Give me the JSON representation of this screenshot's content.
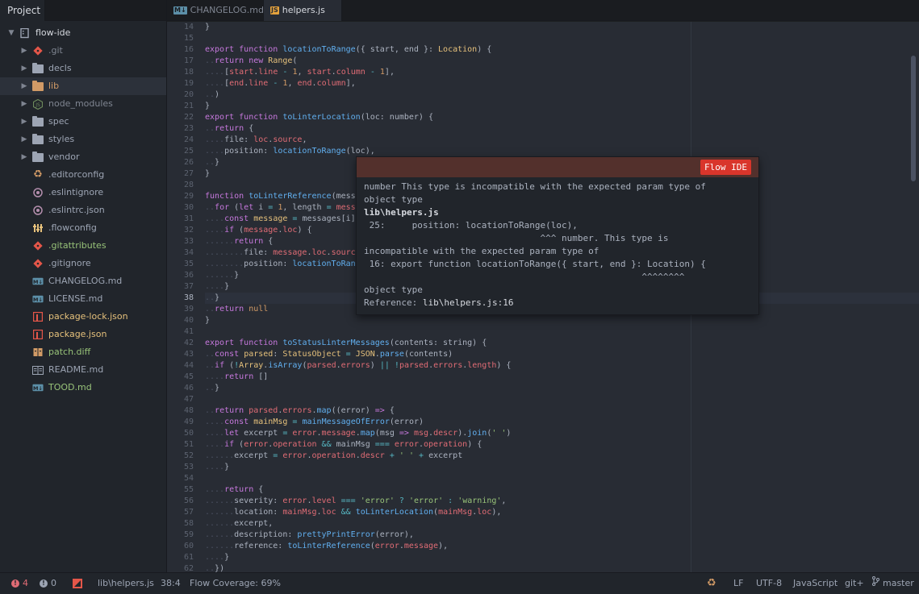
{
  "sidebar": {
    "tab_label": "Project",
    "root": "flow-ide",
    "items": [
      {
        "label": "git",
        "display": ".git",
        "type": "folder",
        "color": "#7f8591",
        "icon": "git-icon"
      },
      {
        "label": "decls",
        "display": "decls",
        "type": "folder",
        "color": "#9da5b4",
        "icon": "folder-icon"
      },
      {
        "label": "lib",
        "display": "lib",
        "type": "folder",
        "color": "#d19a66",
        "icon": "folder-icon",
        "selected": true
      },
      {
        "label": "node_modules",
        "display": "node_modules",
        "type": "folder",
        "color": "#7f8591",
        "icon": "nodejs-icon"
      },
      {
        "label": "spec",
        "display": "spec",
        "type": "folder",
        "color": "#9da5b4",
        "icon": "folder-icon"
      },
      {
        "label": "styles",
        "display": "styles",
        "type": "folder",
        "color": "#9da5b4",
        "icon": "folder-icon"
      },
      {
        "label": "vendor",
        "display": "vendor",
        "type": "folder",
        "color": "#9da5b4",
        "icon": "folder-icon"
      },
      {
        "label": "editorconfig",
        "display": ".editorconfig",
        "type": "file",
        "color": "#9da5b4",
        "icon": "editorconfig-icon"
      },
      {
        "label": "eslintignore",
        "display": ".eslintignore",
        "type": "file",
        "color": "#9da5b4",
        "icon": "eslint-icon"
      },
      {
        "label": "eslintrc",
        "display": ".eslintrc.json",
        "type": "file",
        "color": "#9da5b4",
        "icon": "eslint-icon"
      },
      {
        "label": "flowconfig",
        "display": ".flowconfig",
        "type": "file",
        "color": "#9da5b4",
        "icon": "config-icon"
      },
      {
        "label": "gitattributes",
        "display": ".gitattributes",
        "type": "file",
        "color": "#98c379",
        "icon": "git-icon"
      },
      {
        "label": "gitignore",
        "display": ".gitignore",
        "type": "file",
        "color": "#9da5b4",
        "icon": "git-icon"
      },
      {
        "label": "changelog",
        "display": "CHANGELOG.md",
        "type": "file",
        "color": "#9da5b4",
        "icon": "markdown-icon"
      },
      {
        "label": "license",
        "display": "LICENSE.md",
        "type": "file",
        "color": "#9da5b4",
        "icon": "markdown-icon"
      },
      {
        "label": "package-lock",
        "display": "package-lock.json",
        "type": "file",
        "color": "#e5c07b",
        "icon": "npm-icon"
      },
      {
        "label": "package",
        "display": "package.json",
        "type": "file",
        "color": "#e5c07b",
        "icon": "npm-icon"
      },
      {
        "label": "patch",
        "display": "patch.diff",
        "type": "file",
        "color": "#98c379",
        "icon": "diff-icon"
      },
      {
        "label": "readme",
        "display": "README.md",
        "type": "file",
        "color": "#9da5b4",
        "icon": "readme-icon"
      },
      {
        "label": "tood",
        "display": "TOOD.md",
        "type": "file",
        "color": "#98c379",
        "icon": "markdown-icon"
      }
    ]
  },
  "tabs": [
    {
      "label": "CHANGELOG.md",
      "icon": "markdown-icon",
      "icon_text": "M↓"
    },
    {
      "label": "helpers.js",
      "icon": "javascript-icon",
      "icon_text": "JS",
      "active": true
    }
  ],
  "editor": {
    "current_line": 38,
    "error_lines": [
      24,
      25,
      57
    ],
    "modified_lines": [
      22
    ],
    "lines": [
      {
        "n": 14,
        "html": "<span>}</span>"
      },
      {
        "n": 15,
        "html": ""
      },
      {
        "n": 16,
        "html": "<span class='kw'>export</span> <span class='kw'>function</span> <span class='fn'>locationToRange</span>({ start, end }: <span class='ty'>Location</span>) {"
      },
      {
        "n": 17,
        "html": "<span class='ind'>..</span><span class='kw'>return</span> <span class='kw'>new</span> <span class='ty'>Range</span>("
      },
      {
        "n": 18,
        "html": "<span class='ind'>....</span>[<span class='pr'>start</span>.<span class='pr'>line</span> <span class='op'>-</span> <span class='nu'>1</span>, <span class='pr'>start</span>.<span class='pr'>column</span> <span class='op'>-</span> <span class='nu'>1</span>],"
      },
      {
        "n": 19,
        "html": "<span class='ind'>....</span>[<span class='pr'>end</span>.<span class='pr'>line</span> <span class='op'>-</span> <span class='nu'>1</span>, <span class='pr'>end</span>.<span class='pr'>column</span>],"
      },
      {
        "n": 20,
        "html": "<span class='ind'>..</span>)"
      },
      {
        "n": 21,
        "html": "}"
      },
      {
        "n": 22,
        "html": "<span class='kw'>export</span> <span class='kw'>function</span> <span class='fn'>toLinterLocation</span>(loc: number) {"
      },
      {
        "n": 23,
        "html": "<span class='ind'>..</span><span class='kw'>return</span> {"
      },
      {
        "n": 24,
        "html": "<span class='ind'>....</span>file: <span class='pr'>loc</span>.<span class='pr'>source</span>,"
      },
      {
        "n": 25,
        "html": "<span class='ind'>....</span>position: <span class='fn'>locationToRange</span>(loc),"
      },
      {
        "n": 26,
        "html": "<span class='ind'>..</span>}"
      },
      {
        "n": 27,
        "html": "}"
      },
      {
        "n": 28,
        "html": ""
      },
      {
        "n": 29,
        "html": "<span class='kw'>function</span> <span class='fn'>toLinterReference</span>(messa"
      },
      {
        "n": 30,
        "html": "<span class='ind'>..</span><span class='kw'>for</span> (<span class='kw'>let</span> i <span class='op'>=</span> <span class='nu'>1</span>, length <span class='op'>=</span> <span class='pr'>mess</span>"
      },
      {
        "n": 31,
        "html": "<span class='ind'>....</span><span class='kw'>const</span> <span class='ty'>message</span> <span class='op'>=</span> messages[i]"
      },
      {
        "n": 32,
        "html": "<span class='ind'>....</span><span class='kw'>if</span> (<span class='pr'>message</span>.<span class='pr'>loc</span>) {"
      },
      {
        "n": 33,
        "html": "<span class='ind'>......</span><span class='kw'>return</span> {"
      },
      {
        "n": 34,
        "html": "<span class='ind'>........</span>file: <span class='pr'>message</span>.<span class='pr'>loc</span>.<span class='pr'>sourc</span>"
      },
      {
        "n": 35,
        "html": "<span class='ind'>........</span>position: <span class='fn'>locationToRan</span>"
      },
      {
        "n": 36,
        "html": "<span class='ind'>......</span>}"
      },
      {
        "n": 37,
        "html": "<span class='ind'>....</span>}"
      },
      {
        "n": 38,
        "html": "<span class='ind'>..</span>}"
      },
      {
        "n": 39,
        "html": "<span class='ind'>..</span><span class='kw'>return</span> <span class='nu'>null</span>"
      },
      {
        "n": 40,
        "html": "}"
      },
      {
        "n": 41,
        "html": ""
      },
      {
        "n": 42,
        "html": "<span class='kw'>export</span> <span class='kw'>function</span> <span class='fn'>toStatusLinterMessages</span>(contents: string) {"
      },
      {
        "n": 43,
        "html": "<span class='ind'>..</span><span class='kw'>const</span> <span class='ty'>parsed</span>: <span class='ty'>StatusObject</span> <span class='op'>=</span> <span class='ty'>JSON</span>.<span class='fn'>parse</span>(contents)"
      },
      {
        "n": 44,
        "html": "<span class='ind'>..</span><span class='kw'>if</span> (<span class='op'>!</span><span class='ty'>Array</span>.<span class='fn'>isArray</span>(<span class='pr'>parsed</span>.<span class='pr'>errors</span>) <span class='op'>||</span> <span class='op'>!</span><span class='pr'>parsed</span>.<span class='pr'>errors</span>.<span class='pr'>length</span>) {"
      },
      {
        "n": 45,
        "html": "<span class='ind'>....</span><span class='kw'>return</span> []"
      },
      {
        "n": 46,
        "html": "<span class='ind'>..</span>}"
      },
      {
        "n": 47,
        "html": ""
      },
      {
        "n": 48,
        "html": "<span class='ind'>..</span><span class='kw'>return</span> <span class='pr'>parsed</span>.<span class='pr'>errors</span>.<span class='fn'>map</span>((error) <span class='kw'>=&gt;</span> {"
      },
      {
        "n": 49,
        "html": "<span class='ind'>....</span><span class='kw'>const</span> <span class='ty'>mainMsg</span> <span class='op'>=</span> <span class='fn'>mainMessageOfError</span>(error)"
      },
      {
        "n": 50,
        "html": "<span class='ind'>....</span><span class='kw'>let</span> excerpt <span class='op'>=</span> <span class='pr'>error</span>.<span class='pr'>message</span>.<span class='fn'>map</span>(msg <span class='kw'>=&gt;</span> <span class='pr'>msg</span>.<span class='pr'>descr</span>).<span class='fn'>join</span>(<span class='st'>' '</span>)"
      },
      {
        "n": 51,
        "html": "<span class='ind'>....</span><span class='kw'>if</span> (<span class='pr'>error</span>.<span class='pr'>operation</span> <span class='op'>&amp;&amp;</span> mainMsg <span class='op'>===</span> <span class='pr'>error</span>.<span class='pr'>operation</span>) {"
      },
      {
        "n": 52,
        "html": "<span class='ind'>......</span>excerpt <span class='op'>=</span> <span class='pr'>error</span>.<span class='pr'>operation</span>.<span class='pr'>descr</span> <span class='op'>+</span> <span class='st'>' '</span> <span class='op'>+</span> excerpt"
      },
      {
        "n": 53,
        "html": "<span class='ind'>....</span>}"
      },
      {
        "n": 54,
        "html": ""
      },
      {
        "n": 55,
        "html": "<span class='ind'>....</span><span class='kw'>return</span> {"
      },
      {
        "n": 56,
        "html": "<span class='ind'>......</span>severity: <span class='pr'>error</span>.<span class='pr'>level</span> <span class='op'>===</span> <span class='st'>'error'</span> <span class='op'>?</span> <span class='st'>'error'</span> <span class='op'>:</span> <span class='st'>'warning'</span>,"
      },
      {
        "n": 57,
        "html": "<span class='ind'>......</span>location: <span class='pr'>mainMsg</span>.<span class='pr'>loc</span> <span class='op'>&amp;&amp;</span> <span class='fn'>toLinterLocation</span>(<span class='pr'>mainMsg</span>.<span class='pr'>loc</span>),"
      },
      {
        "n": 58,
        "html": "<span class='ind'>......</span>excerpt,"
      },
      {
        "n": 59,
        "html": "<span class='ind'>......</span>description: <span class='fn'>prettyPrintError</span>(error),"
      },
      {
        "n": 60,
        "html": "<span class='ind'>......</span>reference: <span class='fn'>toLinterReference</span>(<span class='pr'>error</span>.<span class='pr'>message</span>),"
      },
      {
        "n": 61,
        "html": "<span class='ind'>....</span>}"
      },
      {
        "n": 62,
        "html": "<span class='ind'>..</span>})"
      }
    ]
  },
  "tooltip": {
    "badge": "Flow IDE",
    "line1": "number This type is incompatible with the expected param type of",
    "line2": "object type",
    "file": "lib\\helpers.js",
    "line25": " 25:     position: locationToRange(loc),",
    "caret1": "                                 ^^^ number. This type is",
    "line5": "incompatible with the expected param type of",
    "line16": " 16: export function locationToRange({ start, end }: Location) {",
    "caret2": "                                                    ^^^^^^^^",
    "line8": "object type",
    "ref_label": "Reference: ",
    "ref_value": "lib\\helpers.js:16"
  },
  "statusbar": {
    "errors": "4",
    "warnings": "0",
    "file_path": "lib\\helpers.js",
    "cursor": "38:4",
    "coverage": "Flow Coverage: 69%",
    "line_ending": "LF",
    "encoding": "UTF-8",
    "grammar": "JavaScript",
    "git": "git+",
    "branch": "master"
  }
}
